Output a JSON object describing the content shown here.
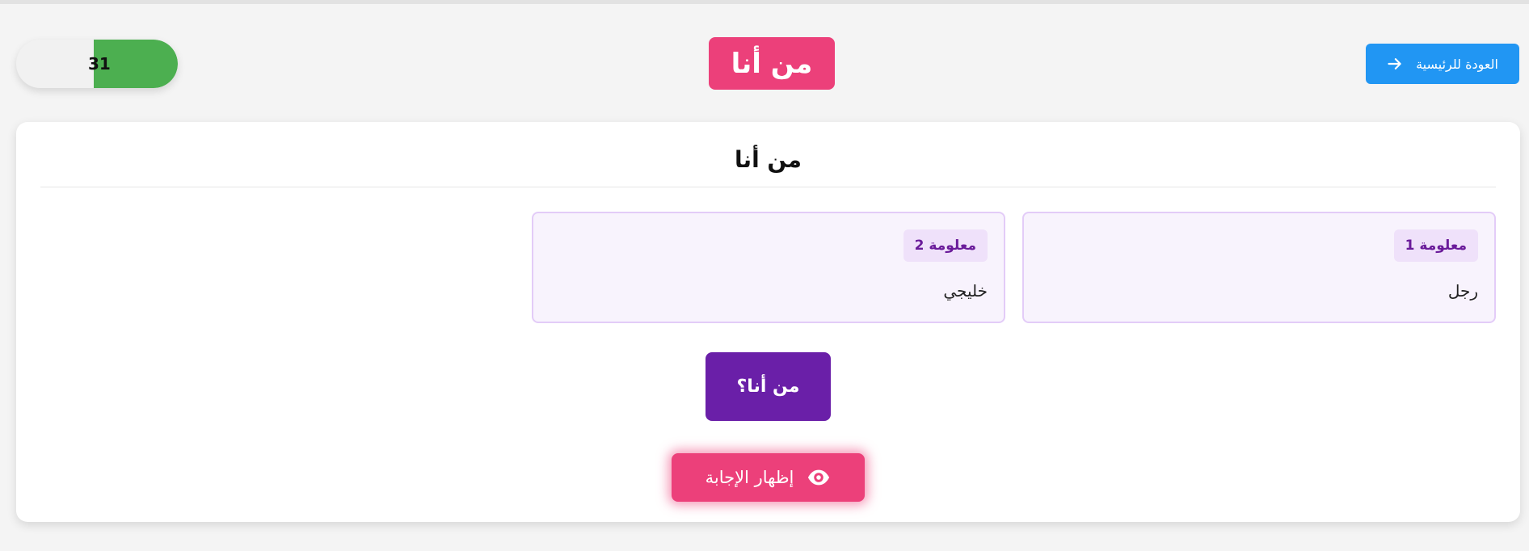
{
  "header": {
    "back_label": "العودة للرئيسية",
    "title": "من أنا",
    "timer": {
      "value": "31",
      "progress": 0.52,
      "color": "#4caf50"
    }
  },
  "card": {
    "title": "من أنا",
    "hints": [
      {
        "badge": "معلومة 1",
        "text": "رجل"
      },
      {
        "badge": "معلومة 2",
        "text": "خليجي"
      }
    ],
    "who_button_label": "من أنا؟",
    "reveal_button_label": "إظهار الإجابة"
  },
  "colors": {
    "primary_blue": "#2196f3",
    "accent_pink": "#ec407a",
    "accent_purple": "#6a1fa8",
    "timer_green": "#4caf50"
  },
  "icons": {
    "back": "arrow-right-icon",
    "reveal": "eye-icon"
  }
}
